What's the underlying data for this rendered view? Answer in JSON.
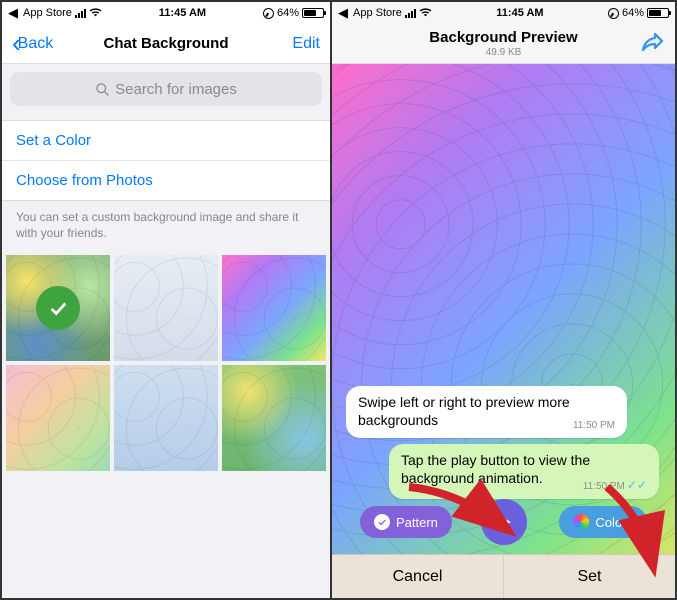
{
  "left": {
    "status": {
      "back_app": "App Store",
      "time": "11:45 AM",
      "battery": "64%"
    },
    "nav": {
      "back": "Back",
      "title": "Chat Background",
      "edit": "Edit"
    },
    "search_placeholder": "Search for images",
    "rows": {
      "set_color": "Set a Color",
      "choose_photos": "Choose from Photos"
    },
    "hint": "You can set a custom background image and share it with your friends."
  },
  "right": {
    "status": {
      "back_app": "App Store",
      "time": "11:45 AM",
      "battery": "64%"
    },
    "nav": {
      "title": "Background Preview",
      "subtitle": "49.9 KB"
    },
    "bubbles": {
      "b1_text": "Swipe left or right to preview more backgrounds",
      "b1_time": "11:50 PM",
      "b2_text": "Tap the play button to view the background animation.",
      "b2_time": "11:50 PM"
    },
    "pills": {
      "pattern": "Pattern",
      "colors": "Colors"
    },
    "footer": {
      "cancel": "Cancel",
      "set": "Set"
    }
  }
}
